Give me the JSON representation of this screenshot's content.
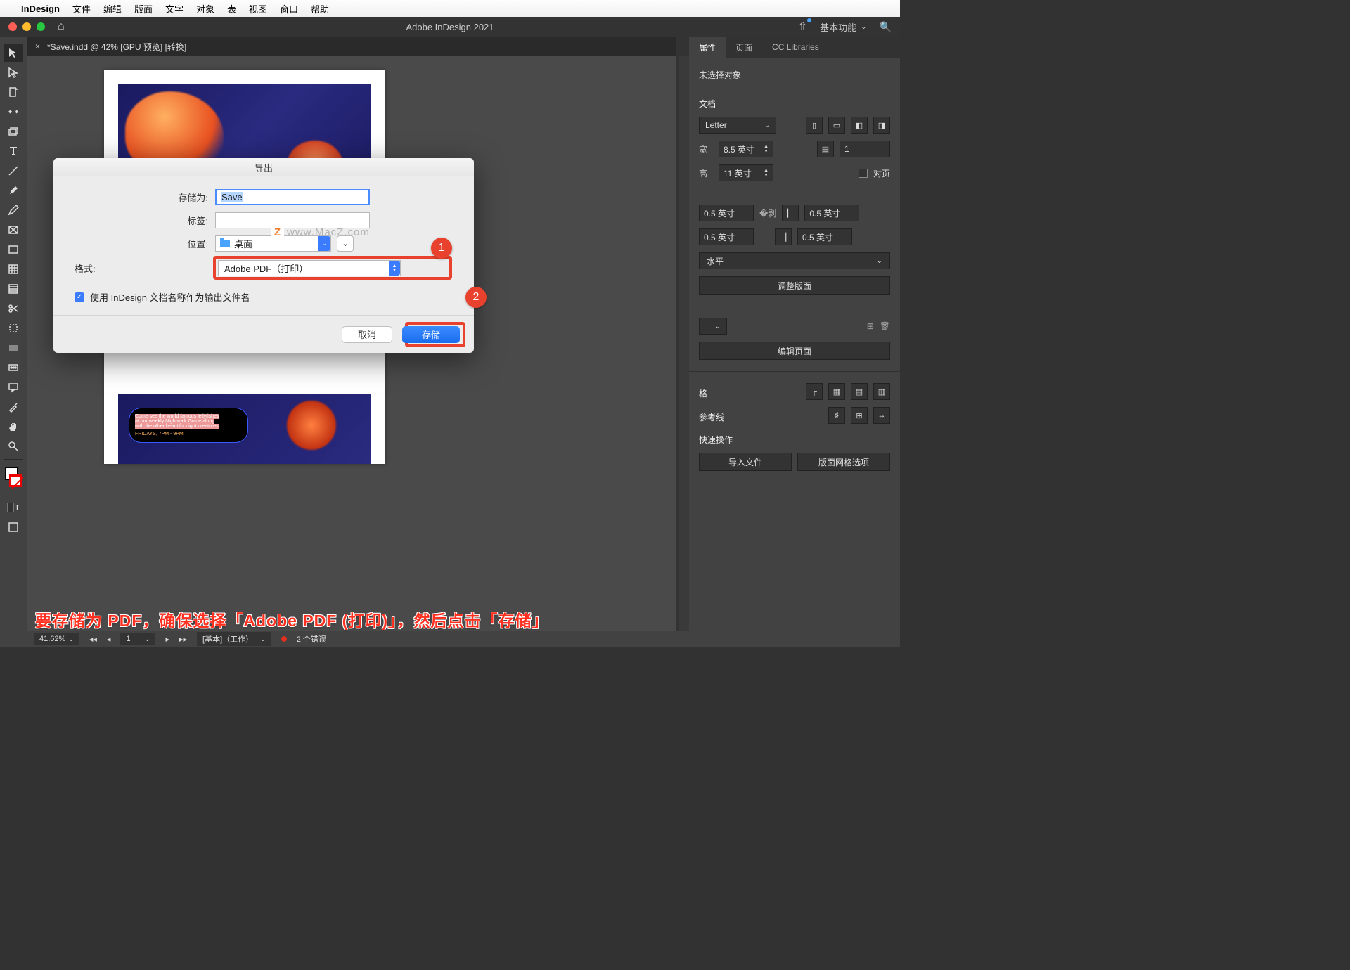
{
  "menubar": {
    "app_name": "InDesign",
    "items": [
      "文件",
      "编辑",
      "版面",
      "文字",
      "对象",
      "表",
      "视图",
      "窗口",
      "帮助"
    ]
  },
  "titlebar": {
    "title": "Adobe InDesign 2021",
    "workspace": "基本功能"
  },
  "doc_tab": {
    "label": "*Save.indd @ 42% [GPU 预览] [转换]"
  },
  "right_panel": {
    "tabs": [
      "属性",
      "页面",
      "CC Libraries"
    ],
    "no_selection": "未选择对象",
    "section_doc": "文档",
    "page_size": "Letter",
    "width_label": "宽",
    "width_value": "8.5 英寸",
    "height_label": "高",
    "height_value": "11 英寸",
    "binding_value": "1",
    "facing_label": "对页",
    "margin_top": "0.5 英寸",
    "margin_bottom": "0.5 英寸",
    "margin_left": "0.5 英寸",
    "margin_right": "0.5 英寸",
    "orient": "水平",
    "adjust_layout": "调整版面",
    "edit_page": "编辑页面",
    "grid_section": "格",
    "guide_section": "参考线",
    "quick_section": "快速操作",
    "import_file": "导入文件",
    "layout_grid_options": "版面网格选项"
  },
  "dialog": {
    "title": "导出",
    "save_as_label": "存储为:",
    "save_as_value": "Save",
    "tags_label": "标签:",
    "location_label": "位置:",
    "location_value": "桌面",
    "format_label": "格式:",
    "format_value": "Adobe PDF（打印）",
    "use_docname": "使用 InDesign 文档名称作为输出文件名",
    "cancel": "取消",
    "save": "存储",
    "watermark": "www.MacZ.com"
  },
  "badges": {
    "one": "1",
    "two": "2"
  },
  "instruction": "要存储为 PDF，确保选择「Adobe PDF (打印)」，然后点击「存储」",
  "statusbar": {
    "zoom": "41.62%",
    "page": "1",
    "preset": "[基本]（工作）",
    "errors": "2 个错误"
  },
  "canvas_text": {
    "line1": "Come see the world famous jellyfishes",
    "line2": "at our weekly Nightwalk Guide along",
    "line3": "with the other beautiful night creatures",
    "line4": "FRIDAYS, 7PM - 9PM"
  }
}
